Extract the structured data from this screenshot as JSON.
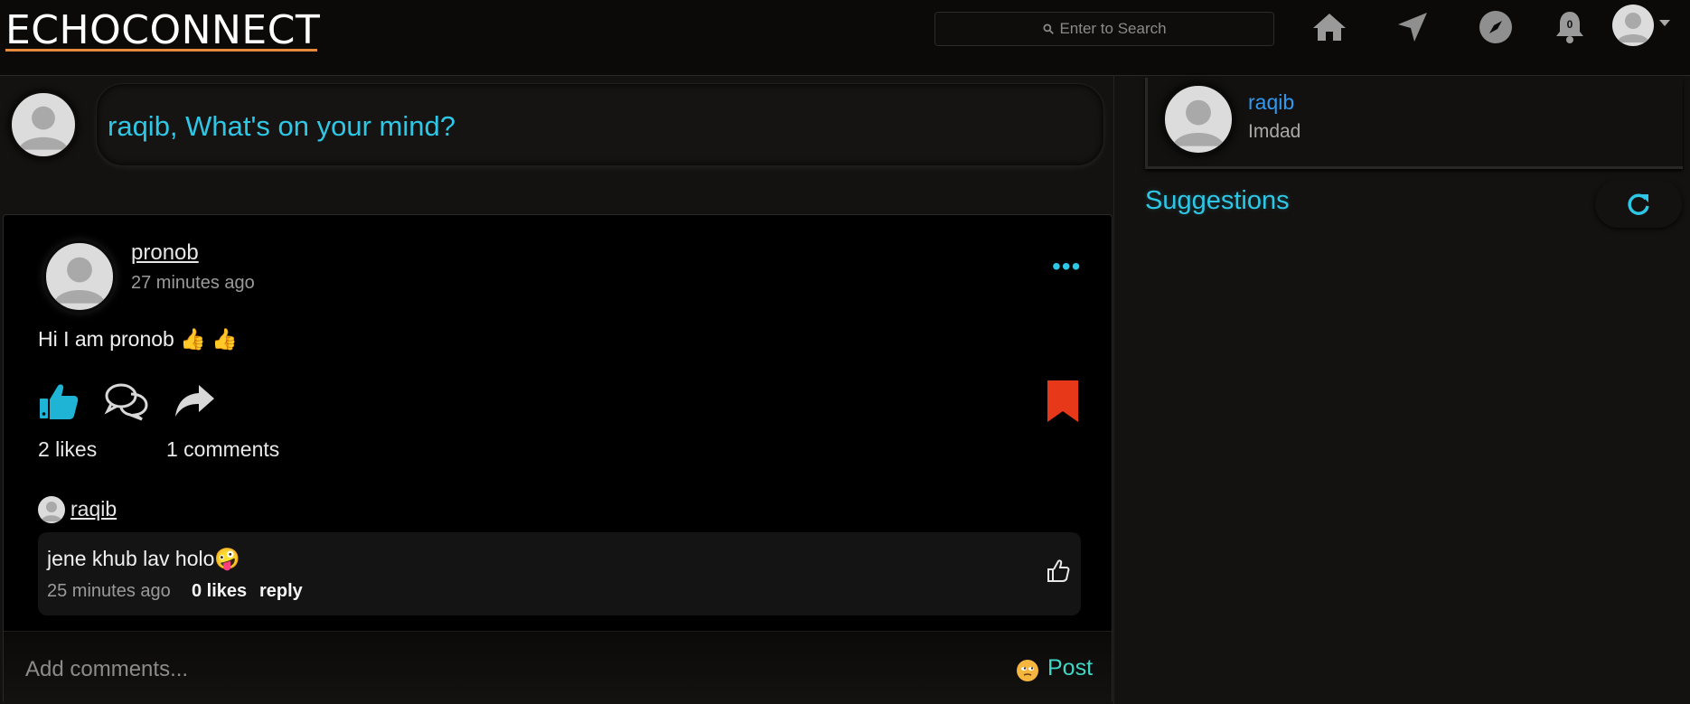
{
  "nav": {
    "brand": "ECHOCONNECT",
    "search_placeholder": "Enter to Search",
    "notification_count": "0",
    "icons": [
      "home-icon",
      "send-icon",
      "explore-icon",
      "bell-icon",
      "avatar"
    ]
  },
  "composer": {
    "prompt": "raqib, What's on your mind?"
  },
  "post": {
    "author": "pronob",
    "time": "27 minutes ago",
    "body": "Hi I am pronob 👍 👍",
    "likes": "2 likes",
    "comments": "1 comments",
    "comment": {
      "author": "raqib",
      "text": "jene khub lav holo🤪",
      "time": "25 minutes ago",
      "likes": "0 likes",
      "reply": "reply"
    },
    "add_comment_placeholder": "Add comments...",
    "emoji": "🙄",
    "post_label": "Post"
  },
  "profile": {
    "name": "raqib",
    "subtitle": "Imdad"
  },
  "suggestions": {
    "title": "Suggestions"
  },
  "colors": {
    "accent": "#2ec7e6",
    "bookmark": "#e8381a",
    "brand_underline": "#e58a3c",
    "post_btn": "#3fd6c5"
  }
}
